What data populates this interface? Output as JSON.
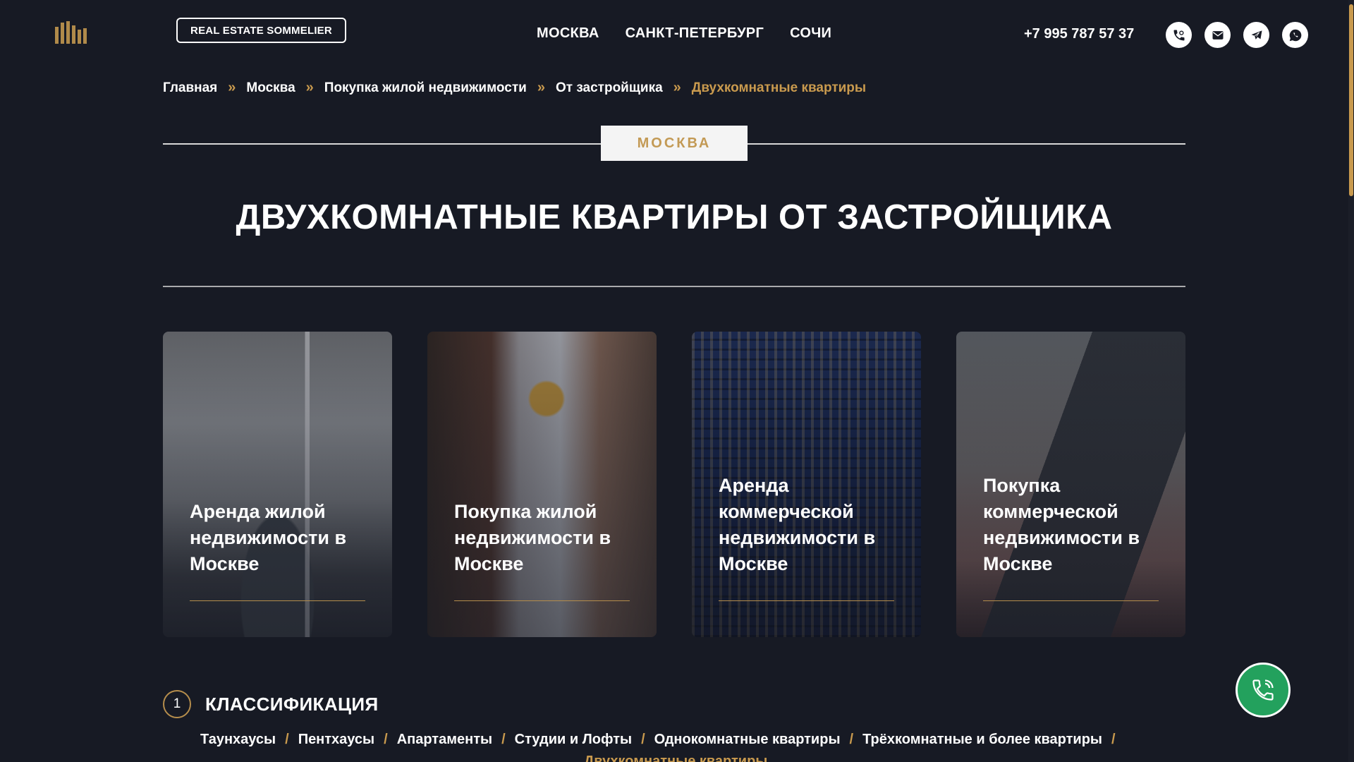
{
  "header": {
    "brand_button": "REAL ESTATE SOMMELIER",
    "nav": [
      "МОСКВА",
      "САНКТ-ПЕТЕРБУРГ",
      "СОЧИ"
    ],
    "phone": "+7 995 787 57 37",
    "social_icons": [
      "phone-icon",
      "mail-icon",
      "telegram-icon",
      "whatsapp-icon"
    ]
  },
  "breadcrumb": [
    "Главная",
    "Москва",
    "Покупка жилой недвижимости",
    "От застройщика",
    "Двухкомнатные квартиры"
  ],
  "breadcrumb_separator": "»",
  "city_badge": "МОСКВА",
  "page_title": "ДВУХКОМНАТНЫЕ КВАРТИРЫ ОТ ЗАСТРОЙЩИКА",
  "cards": [
    {
      "label": "Аренда жилой недвижимости в Москве"
    },
    {
      "label": "Покупка жилой недвижимости в Москве"
    },
    {
      "label": "Аренда коммерческой недвижимости в Москве"
    },
    {
      "label": "Покупка коммерческой недвижимости в Москве"
    }
  ],
  "section": {
    "number": "1",
    "title": "КЛАССИФИКАЦИЯ",
    "links": [
      "Таунхаусы",
      "Пентхаусы",
      "Апартаменты",
      "Студии и Лофты",
      "Однокомнатные квартиры",
      "Трёхкомнатные и более квартиры"
    ],
    "active_link": "Двухкомнатные квартиры",
    "separator": "/"
  },
  "colors": {
    "background": "#171a24",
    "accent_gold": "#c99a4e",
    "call_button": "#23a15d"
  }
}
